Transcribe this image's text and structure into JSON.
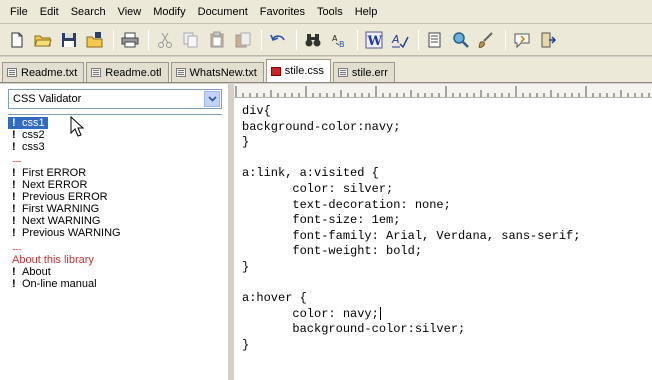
{
  "menu": [
    "File",
    "Edit",
    "Search",
    "View",
    "Modify",
    "Document",
    "Favorites",
    "Tools",
    "Help"
  ],
  "tabs": [
    {
      "label": "Readme.txt",
      "active": false
    },
    {
      "label": "Readme.otl",
      "active": false
    },
    {
      "label": "WhatsNew.txt",
      "active": false
    },
    {
      "label": "stile.css",
      "active": true
    },
    {
      "label": "stile.err",
      "active": false
    }
  ],
  "left": {
    "selector_value": "CSS Validator",
    "items": [
      {
        "type": "item",
        "label": "css1",
        "selected": true
      },
      {
        "type": "item",
        "label": "css2"
      },
      {
        "type": "item",
        "label": "css3"
      },
      {
        "type": "sep",
        "label": "......"
      },
      {
        "type": "item",
        "label": "First ERROR"
      },
      {
        "type": "item",
        "label": "Next ERROR"
      },
      {
        "type": "item",
        "label": "Previous ERROR"
      },
      {
        "type": "item",
        "label": "First WARNING"
      },
      {
        "type": "item",
        "label": "Next WARNING"
      },
      {
        "type": "item",
        "label": "Previous WARNING"
      },
      {
        "type": "sep",
        "label": "......"
      },
      {
        "type": "section",
        "label": "About this library"
      },
      {
        "type": "item",
        "label": "About"
      },
      {
        "type": "item",
        "label": "On-line manual"
      }
    ]
  },
  "editor": {
    "lines": [
      "div{",
      "background-color:navy;",
      "}",
      "",
      "a:link, a:visited {",
      "       color: silver;",
      "       text-decoration: none;",
      "       font-size: 1em;",
      "       font-family: Arial, Verdana, sans-serif;",
      "       font-weight: bold;",
      "}",
      "",
      "a:hover {",
      "       color: navy;",
      "       background-color:silver;",
      "}"
    ]
  },
  "colors": {
    "selection": "#316ac5",
    "section_text": "#c83232",
    "active_tab_icon": "#cc2222"
  }
}
